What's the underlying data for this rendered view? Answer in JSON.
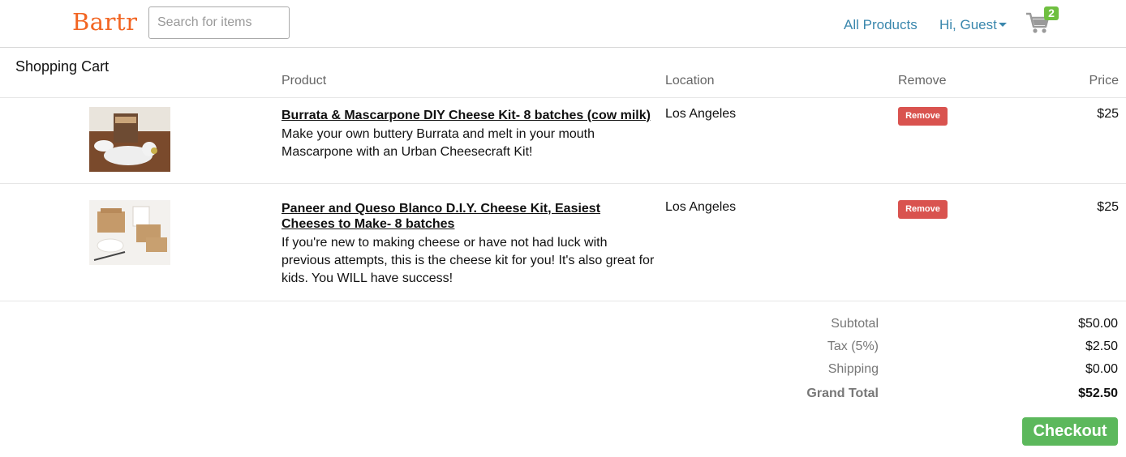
{
  "nav": {
    "brand": "Bartr",
    "search_placeholder": "Search for items",
    "all_products": "All Products",
    "user_menu": "Hi, Guest",
    "cart_count": "2"
  },
  "cart": {
    "title": "Shopping Cart",
    "columns": {
      "product": "Product",
      "location": "Location",
      "remove": "Remove",
      "price": "Price"
    },
    "items": [
      {
        "title": "Burrata & Mascarpone DIY Cheese Kit- 8 batches (cow milk)",
        "description": "Make your own buttery Burrata and melt in your mouth Mascarpone with an Urban Cheesecraft Kit!",
        "location": "Los Angeles",
        "remove_label": "Remove",
        "price": "$25"
      },
      {
        "title": "Paneer and Queso Blanco D.I.Y. Cheese Kit, Easiest Cheeses to Make- 8 batches",
        "description": "If you're new to making cheese or have not had luck with previous attempts, this is the cheese kit for you! It's also great for kids. You WILL have success!",
        "location": "Los Angeles",
        "remove_label": "Remove",
        "price": "$25"
      }
    ],
    "totals": {
      "subtotal_label": "Subtotal",
      "subtotal": "$50.00",
      "tax_label": "Tax (5%)",
      "tax": "$2.50",
      "shipping_label": "Shipping",
      "shipping": "$0.00",
      "grand_total_label": "Grand Total",
      "grand_total": "$52.50"
    },
    "checkout_label": "Checkout"
  },
  "colors": {
    "brand": "#f26522",
    "link": "#3a87ad",
    "remove": "#d9534f",
    "checkout": "#5cb85c",
    "badge": "#6fbf40"
  }
}
